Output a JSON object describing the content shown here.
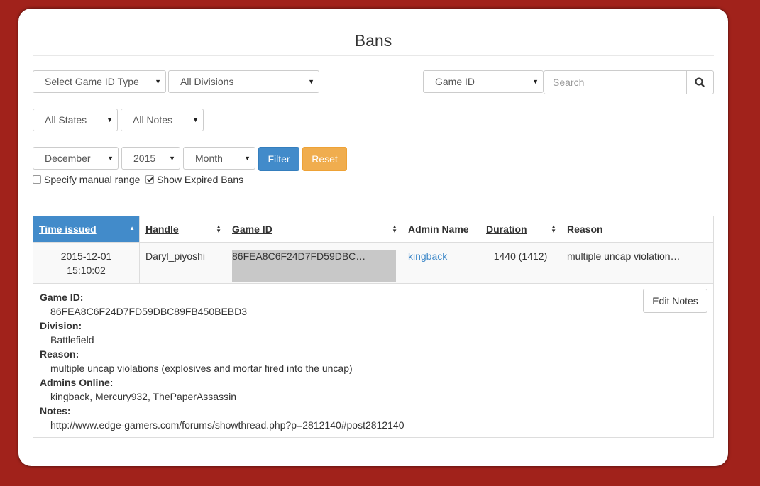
{
  "page": {
    "title": "Bans"
  },
  "filters": {
    "game_id_type": "Select Game ID Type",
    "divisions": "All Divisions",
    "search_field": "Game ID",
    "search_placeholder": "Search",
    "states": "All States",
    "notes": "All Notes",
    "month": "December",
    "year": "2015",
    "period": "Month",
    "filter_label": "Filter",
    "reset_label": "Reset",
    "manual_range_label": "Specify manual range",
    "manual_range_checked": false,
    "show_expired_label": "Show Expired Bans",
    "show_expired_checked": true
  },
  "table": {
    "columns": [
      "Time issued",
      "Handle",
      "Game ID",
      "Admin Name",
      "Duration",
      "Reason"
    ],
    "row": {
      "time_date": "2015-12-01",
      "time_clock": "15:10:02",
      "handle": "Daryl_piyoshi",
      "game_id": "86FEA8C6F24D7FD59DBC…",
      "admin": "kingback",
      "duration": "1440 (1412)",
      "reason": "multiple uncap violation…"
    }
  },
  "details": {
    "game_id_label": "Game ID:",
    "game_id": "86FEA8C6F24D7FD59DBC89FB450BEBD3",
    "division_label": "Division:",
    "division": "Battlefield",
    "reason_label": "Reason:",
    "reason": "multiple uncap violations (explosives and mortar fired into the uncap)",
    "admins_label": "Admins Online:",
    "admins": "kingback, Mercury932, ThePaperAssassin",
    "notes_label": "Notes:",
    "notes": "http://www.edge-gamers.com/forums/showthread.php?p=2812140#post2812140",
    "edit_notes_label": "Edit Notes"
  },
  "colors": {
    "background": "#a1221b",
    "primary": "#428bca",
    "warning": "#f0ad4e"
  }
}
